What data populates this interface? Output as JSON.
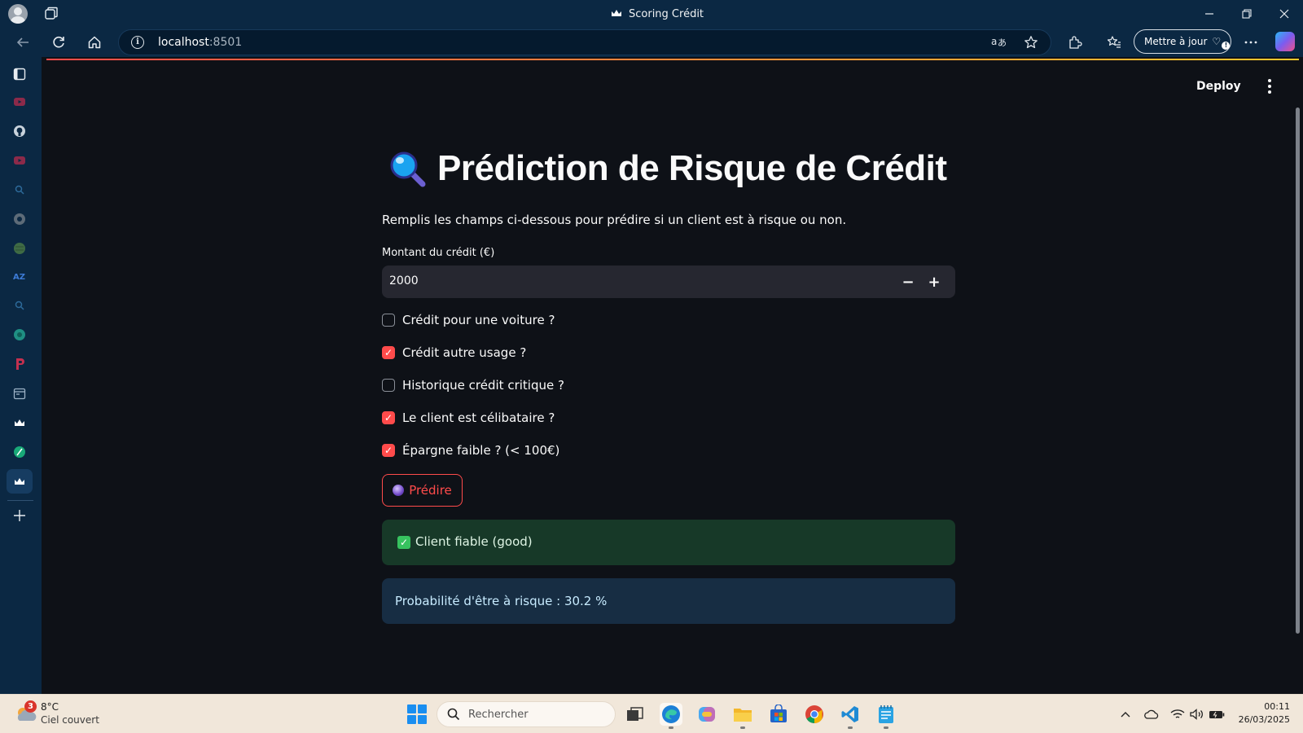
{
  "window": {
    "title": "Scoring Crédit"
  },
  "browser": {
    "url_host": "localhost",
    "url_port": ":8501",
    "update_button": "Mettre à jour"
  },
  "app": {
    "deploy_label": "Deploy",
    "title": "Prédiction de Risque de Crédit",
    "subtitle": "Remplis les champs ci-dessous pour prédire si un client est à risque ou non.",
    "amount_field": {
      "label": "Montant du crédit (€)",
      "value": "2000",
      "decrement": "−",
      "increment": "+"
    },
    "checkboxes": [
      {
        "label": "Crédit pour une voiture ?",
        "checked": false
      },
      {
        "label": "Crédit autre usage ?",
        "checked": true
      },
      {
        "label": "Historique crédit critique ?",
        "checked": false
      },
      {
        "label": "Le client est célibataire ?",
        "checked": true
      },
      {
        "label": "Épargne faible ? (< 100€)",
        "checked": true
      }
    ],
    "predict_button": "Prédire",
    "result_success": "Client fiable (good)",
    "result_probability": "Probabilité d'être à risque : 30.2 %",
    "colors": {
      "accent": "#ff4b4b",
      "success_bg": "#173928",
      "info_bg": "#172d43",
      "background": "#0e1117"
    }
  },
  "taskbar": {
    "weather_badge": "3",
    "weather_temp": "8°C",
    "weather_desc": "Ciel couvert",
    "search_placeholder": "Rechercher",
    "time": "00:11",
    "date": "26/03/2025"
  }
}
